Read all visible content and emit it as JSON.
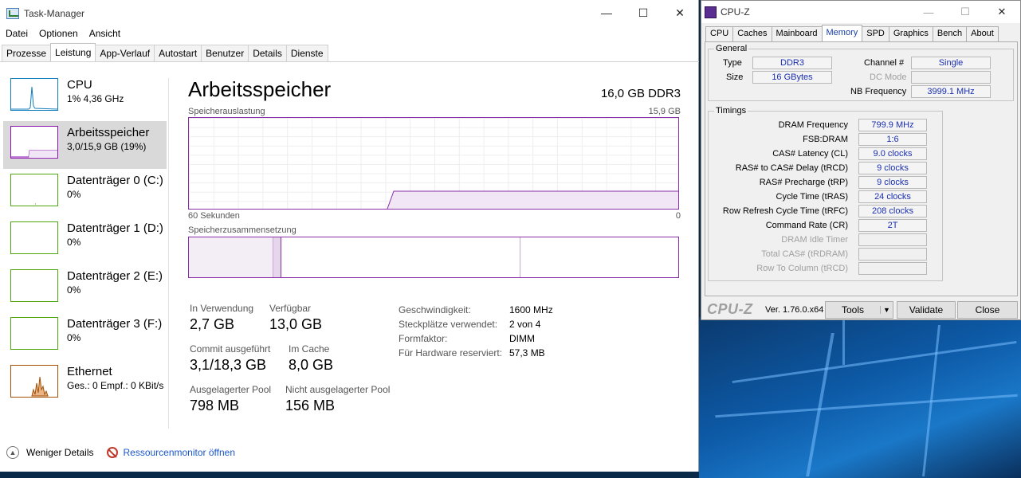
{
  "taskmanager": {
    "title": "Task-Manager",
    "window_buttons": [
      "—",
      "☐",
      "✕"
    ],
    "menu": [
      "Datei",
      "Optionen",
      "Ansicht"
    ],
    "tabs": [
      "Prozesse",
      "Leistung",
      "App-Verlauf",
      "Autostart",
      "Benutzer",
      "Details",
      "Dienste"
    ],
    "active_tab": "Leistung",
    "sidebar": [
      {
        "name": "CPU",
        "sub": "1% 4,36 GHz",
        "color": "#117dbb"
      },
      {
        "name": "Arbeitsspeicher",
        "sub": "3,0/15,9 GB (19%)",
        "color": "#8b12ae"
      },
      {
        "name": "Datenträger 0 (C:)",
        "sub": "0%",
        "color": "#4da60c"
      },
      {
        "name": "Datenträger 1 (D:)",
        "sub": "0%",
        "color": "#4da60c"
      },
      {
        "name": "Datenträger 2 (E:)",
        "sub": "0%",
        "color": "#4da60c"
      },
      {
        "name": "Datenträger 3 (F:)",
        "sub": "0%",
        "color": "#4da60c"
      },
      {
        "name": "Ethernet",
        "sub": "Ges.: 0 Empf.: 0 KBit/s",
        "color": "#a74f01"
      }
    ],
    "main": {
      "title": "Arbeitsspeicher",
      "spec": "16,0 GB DDR3",
      "graph1_label": "Speicherauslastung",
      "graph1_max": "15,9 GB",
      "graph1_time": "60 Sekunden",
      "graph1_zero": "0",
      "graph2_label": "Speicherzusammensetzung",
      "accent": "#8b2fa8"
    },
    "stats": {
      "in_use_label": "In Verwendung",
      "in_use_value": "2,7 GB",
      "available_label": "Verfügbar",
      "available_value": "13,0 GB",
      "commit_label": "Commit ausgeführt",
      "commit_value": "3,1/18,3 GB",
      "cached_label": "Im Cache",
      "cached_value": "8,0 GB",
      "paged_label": "Ausgelagerter Pool",
      "paged_value": "798 MB",
      "nonpaged_label": "Nicht ausgelagerter Pool",
      "nonpaged_value": "156 MB"
    },
    "details": [
      {
        "key": "Geschwindigkeit:",
        "value": "1600 MHz"
      },
      {
        "key": "Steckplätze verwendet:",
        "value": "2 von 4"
      },
      {
        "key": "Formfaktor:",
        "value": "DIMM"
      },
      {
        "key": "Für Hardware reserviert:",
        "value": "57,3 MB"
      }
    ],
    "footer": {
      "fewer_details": "Weniger Details",
      "resource_monitor": "Ressourcenmonitor öffnen"
    }
  },
  "cpuz": {
    "title": "CPU-Z",
    "tabs": [
      "CPU",
      "Caches",
      "Mainboard",
      "Memory",
      "SPD",
      "Graphics",
      "Bench",
      "About"
    ],
    "active_tab": "Memory",
    "general_label": "General",
    "type_label": "Type",
    "type_value": "DDR3",
    "size_label": "Size",
    "size_value": "16 GBytes",
    "channel_label": "Channel #",
    "channel_value": "Single",
    "dcmode_label": "DC Mode",
    "dcmode_value": "",
    "nbfreq_label": "NB Frequency",
    "nbfreq_value": "3999.1 MHz",
    "timings_label": "Timings",
    "timings": [
      {
        "label": "DRAM Frequency",
        "value": "799.9 MHz",
        "enabled": true
      },
      {
        "label": "FSB:DRAM",
        "value": "1:6",
        "enabled": true
      },
      {
        "label": "CAS# Latency (CL)",
        "value": "9.0 clocks",
        "enabled": true
      },
      {
        "label": "RAS# to CAS# Delay (tRCD)",
        "value": "9 clocks",
        "enabled": true
      },
      {
        "label": "RAS# Precharge (tRP)",
        "value": "9 clocks",
        "enabled": true
      },
      {
        "label": "Cycle Time (tRAS)",
        "value": "24 clocks",
        "enabled": true
      },
      {
        "label": "Row Refresh Cycle Time (tRFC)",
        "value": "208 clocks",
        "enabled": true
      },
      {
        "label": "Command Rate (CR)",
        "value": "2T",
        "enabled": true
      },
      {
        "label": "DRAM Idle Timer",
        "value": "",
        "enabled": false
      },
      {
        "label": "Total CAS# (tRDRAM)",
        "value": "",
        "enabled": false
      },
      {
        "label": "Row To Column (tRCD)",
        "value": "",
        "enabled": false
      }
    ],
    "logo": "CPU-Z",
    "version": "Ver. 1.76.0.x64",
    "tools_label": "Tools",
    "validate_label": "Validate",
    "close_label": "Close"
  }
}
